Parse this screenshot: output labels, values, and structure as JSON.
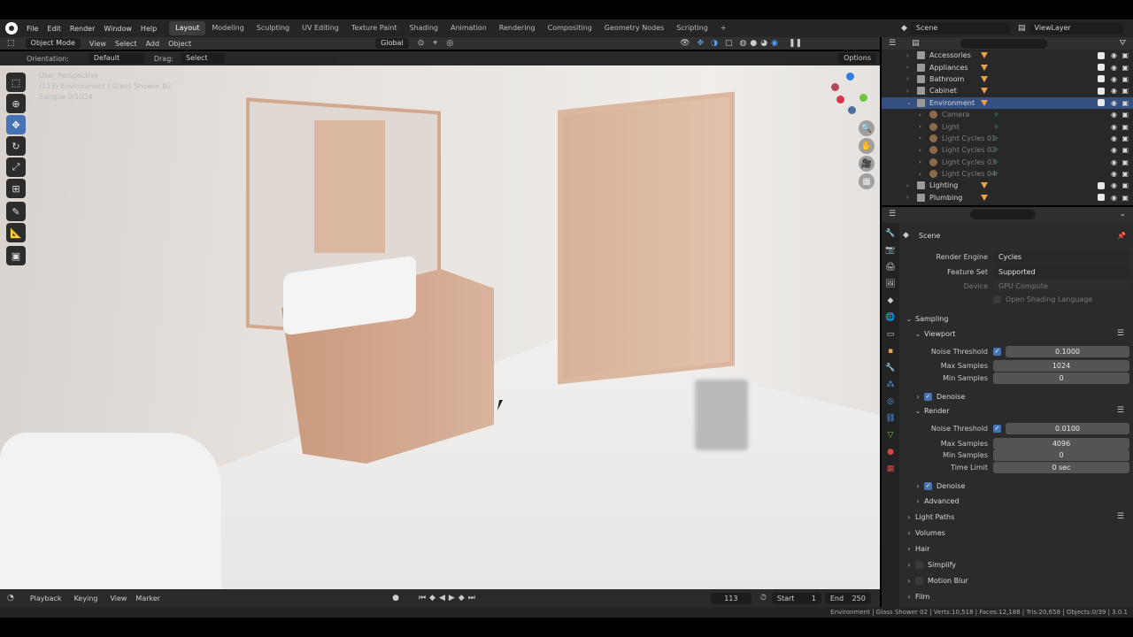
{
  "menubar": {
    "menus": [
      "File",
      "Edit",
      "Render",
      "Window",
      "Help"
    ],
    "workspaces": [
      "Layout",
      "Modeling",
      "Sculpting",
      "UV Editing",
      "Texture Paint",
      "Shading",
      "Animation",
      "Rendering",
      "Compositing",
      "Geometry Nodes",
      "Scripting"
    ],
    "active_workspace": "Layout",
    "add_tab": "+",
    "scene": "Scene",
    "view_layer": "ViewLayer"
  },
  "vp_header": {
    "mode": "Object Mode",
    "menus": [
      "View",
      "Select",
      "Add",
      "Object"
    ],
    "transform": "Global"
  },
  "tool_header": {
    "orientation_label": "Orientation:",
    "orientation_value": "Default",
    "drag_label": "Drag:",
    "drag_value": "Select Box",
    "options": "Options"
  },
  "viewport": {
    "line1": "User Perspective",
    "line2": "(113) Environment | Glass Shower 02",
    "line3": "Sample 0/1024"
  },
  "timeline": {
    "menus": [
      "Playback",
      "Keying",
      "View",
      "Marker"
    ],
    "current_frame": "113",
    "start_label": "Start",
    "start": "1",
    "end_label": "End",
    "end": "250"
  },
  "statusbar": {
    "text": "Environment | Glass Shower 02 | Verts:10,518 | Faces:12,188 | Tris:20,658 | Objects:0/39 | 3.0.1"
  },
  "outliner": {
    "rows": [
      {
        "name": "Accessories",
        "indent": 0,
        "kind": "collection",
        "state": "normal"
      },
      {
        "name": "Appliances",
        "indent": 0,
        "kind": "collection",
        "state": "normal"
      },
      {
        "name": "Bathroom",
        "indent": 0,
        "kind": "collection",
        "state": "normal"
      },
      {
        "name": "Cabinet",
        "indent": 0,
        "kind": "collection",
        "state": "normal"
      },
      {
        "name": "Environment",
        "indent": 0,
        "kind": "collection",
        "state": "selected"
      },
      {
        "name": "Camera",
        "indent": 1,
        "kind": "object",
        "state": "dim"
      },
      {
        "name": "Light",
        "indent": 1,
        "kind": "object",
        "state": "dim"
      },
      {
        "name": "Light Cycles 01",
        "indent": 1,
        "kind": "object",
        "state": "dim"
      },
      {
        "name": "Light Cycles 02",
        "indent": 1,
        "kind": "object",
        "state": "dim"
      },
      {
        "name": "Light Cycles 03",
        "indent": 1,
        "kind": "object",
        "state": "dim"
      },
      {
        "name": "Light Cycles 04",
        "indent": 1,
        "kind": "object",
        "state": "dim"
      },
      {
        "name": "Lighting",
        "indent": 0,
        "kind": "collection",
        "state": "normal"
      },
      {
        "name": "Plumbing",
        "indent": 0,
        "kind": "collection",
        "state": "normal"
      }
    ]
  },
  "properties": {
    "context": "Scene",
    "render_engine_label": "Render Engine",
    "render_engine": "Cycles",
    "feature_set_label": "Feature Set",
    "feature_set": "Supported",
    "device_label": "Device",
    "device": "GPU Compute",
    "osl": "Open Shading Language",
    "sampling": "Sampling",
    "viewport": "Viewport",
    "noise_threshold_label": "Noise Threshold",
    "vp_noise_threshold": "0.1000",
    "max_samples_label": "Max Samples",
    "vp_max_samples": "1024",
    "min_samples_label": "Min Samples",
    "vp_min_samples": "0",
    "denoise": "Denoise",
    "render": "Render",
    "r_noise_threshold": "0.0100",
    "r_max_samples": "4096",
    "r_min_samples": "0",
    "time_limit_label": "Time Limit",
    "time_limit": "0 sec",
    "advanced": "Advanced",
    "light_paths": "Light Paths",
    "volumes": "Volumes",
    "hair": "Hair",
    "simplify": "Simplify",
    "motion_blur": "Motion Blur",
    "film": "Film"
  }
}
